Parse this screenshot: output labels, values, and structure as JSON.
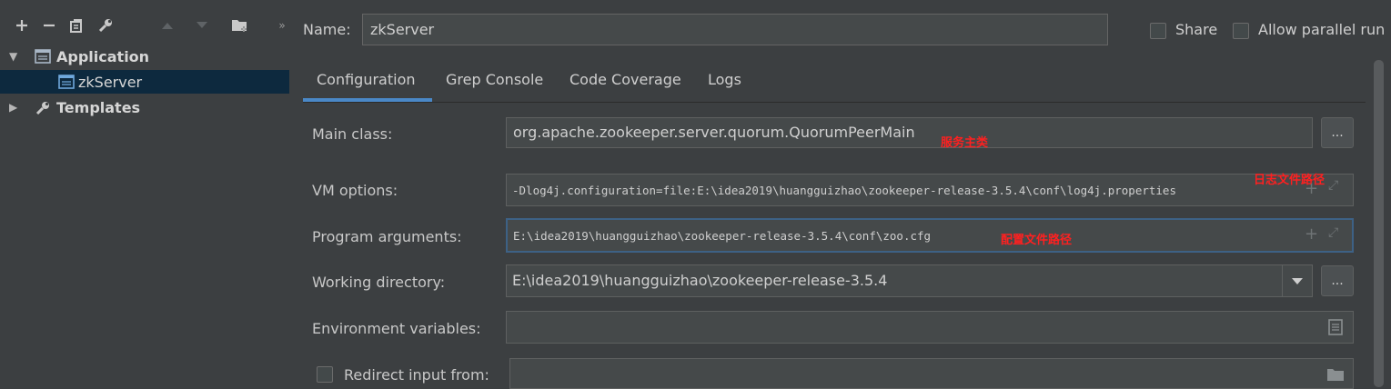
{
  "toolbar": {
    "icons": [
      "add-icon",
      "remove-icon",
      "copy-icon",
      "wrench-icon",
      "move-up-icon",
      "move-down-icon",
      "folder-add-icon",
      "expand-more-icon"
    ]
  },
  "tree": {
    "application": "Application",
    "zkserver": "zkServer",
    "templates": "Templates"
  },
  "header": {
    "name_label": "Name:",
    "name_value": "zkServer",
    "share_label": "Share",
    "parallel_label": "Allow parallel run"
  },
  "tabs": [
    "Configuration",
    "Grep Console",
    "Code Coverage",
    "Logs"
  ],
  "form": {
    "main_class_label": "Main class:",
    "main_class_value": "org.apache.zookeeper.server.quorum.QuorumPeerMain",
    "main_class_note": "服务主类",
    "vm_options_label": "VM options:",
    "vm_options_value": "-Dlog4j.configuration=file:E:\\idea2019\\huangguizhao\\zookeeper-release-3.5.4\\conf\\log4j.properties",
    "vm_options_note": "日志文件路径",
    "program_args_label": "Program arguments:",
    "program_args_value": "E:\\idea2019\\huangguizhao\\zookeeper-release-3.5.4\\conf\\zoo.cfg",
    "program_args_note": "配置文件路径",
    "working_dir_label": "Working directory:",
    "working_dir_value": "E:\\idea2019\\huangguizhao\\zookeeper-release-3.5.4",
    "env_label": "Environment variables:",
    "env_value": "",
    "redirect_label": "Redirect input from:",
    "redirect_value": "",
    "dots": "..."
  },
  "colors": {
    "background": "#3c3f41",
    "selection": "#0d293e",
    "accent": "#4a88c7",
    "annotation": "#ff2020"
  }
}
